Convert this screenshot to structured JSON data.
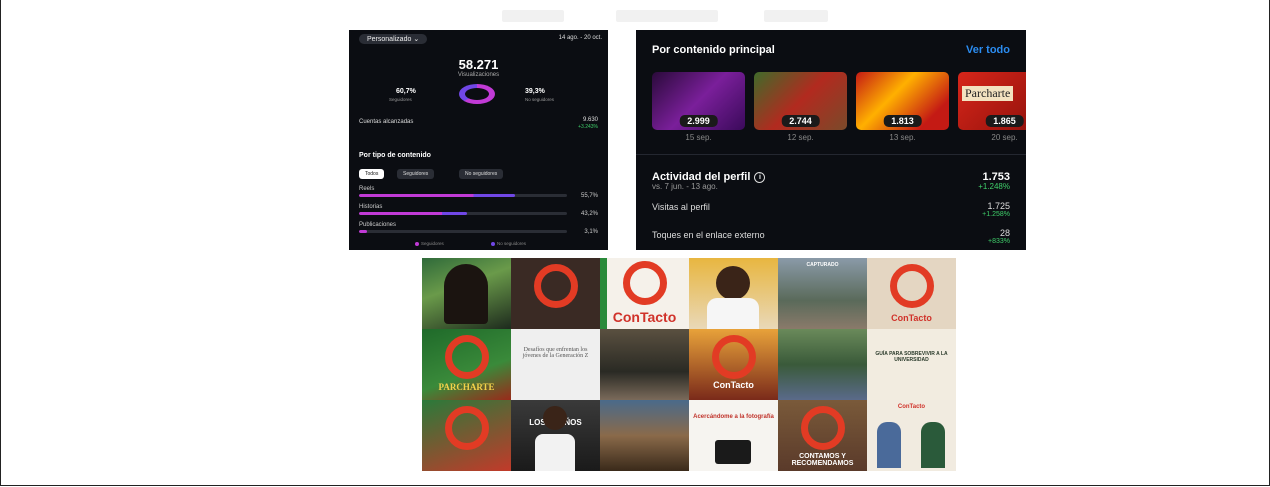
{
  "colors": {
    "panel_bg": "#0b0d12",
    "accent_pink": "#c13ad6",
    "accent_purple": "#7047e6",
    "link_blue": "#2b8cf0",
    "positive_green": "#3fcf6a",
    "brand_red": "#e23b24"
  },
  "left_panel": {
    "period_selector": "Personalizado",
    "period_icon": "chevron-down-icon",
    "date_range": "14 ago. - 20 oct.",
    "total_views": "58.271",
    "total_views_label": "Visualizaciones",
    "followers_pct": "60,7%",
    "followers_label": "Seguidores",
    "non_followers_pct": "39,3%",
    "non_followers_label": "No seguidores",
    "followers_share": 0.607,
    "accounts_label": "Cuentas alcanzadas",
    "accounts_value": "9.630",
    "accounts_change": "+3.243%",
    "by_type_title": "Por tipo de contenido",
    "filters": [
      "Todos",
      "Seguidores",
      "No seguidores"
    ],
    "content_types": [
      {
        "label": "Reels",
        "value": "55,7%",
        "followers_share": 0.55,
        "nonfollowers_share": 0.2
      },
      {
        "label": "Historias",
        "value": "43,2%",
        "followers_share": 0.4,
        "nonfollowers_share": 0.12
      },
      {
        "label": "Publicaciones",
        "value": "3,1%",
        "followers_share": 0.04,
        "nonfollowers_share": 0.0
      }
    ],
    "legend": [
      "Seguidores",
      "No seguidores"
    ]
  },
  "right_panel": {
    "title": "Por contenido principal",
    "see_all": "Ver todo",
    "top_content": [
      {
        "count": "2.999",
        "date": "15 sep."
      },
      {
        "count": "2.744",
        "date": "12 sep."
      },
      {
        "count": "1.813",
        "date": "13 sep."
      },
      {
        "count": "1.865",
        "date": "20 sep.",
        "title": "Parcharte"
      }
    ],
    "activity_title": "Actividad del perfil",
    "activity_info_icon": "info-icon",
    "activity_compare": "vs. 7 jun. - 13 ago.",
    "activity_value": "1.753",
    "activity_change": "+1.248%",
    "metrics": [
      {
        "label": "Visitas al perfil",
        "value": "1.725",
        "change": "+1.258%"
      },
      {
        "label": "Toques en el enlace externo",
        "value": "28",
        "change": "+833%"
      }
    ]
  },
  "grid_posts": [
    {
      "caption": ""
    },
    {
      "caption": ""
    },
    {
      "caption": "ConTacto"
    },
    {
      "caption": ""
    },
    {
      "caption": "CAPTURADO"
    },
    {
      "caption": "ConTacto"
    },
    {
      "caption": "PARCHARTE"
    },
    {
      "caption": "Desafíos que enfrentan los jóvenes de la Generación Z"
    },
    {
      "caption": ""
    },
    {
      "caption": "ConTacto"
    },
    {
      "caption": ""
    },
    {
      "caption": "GUÍA PARA SOBREVIVIR A LA UNIVERSIDAD"
    },
    {
      "caption": ""
    },
    {
      "caption": "LOS SUEÑOS"
    },
    {
      "caption": ""
    },
    {
      "caption": "Acercándome a la fotografía"
    },
    {
      "caption": "CONTAMOS Y RECOMENDAMOS"
    },
    {
      "caption": "ConTacto"
    }
  ]
}
